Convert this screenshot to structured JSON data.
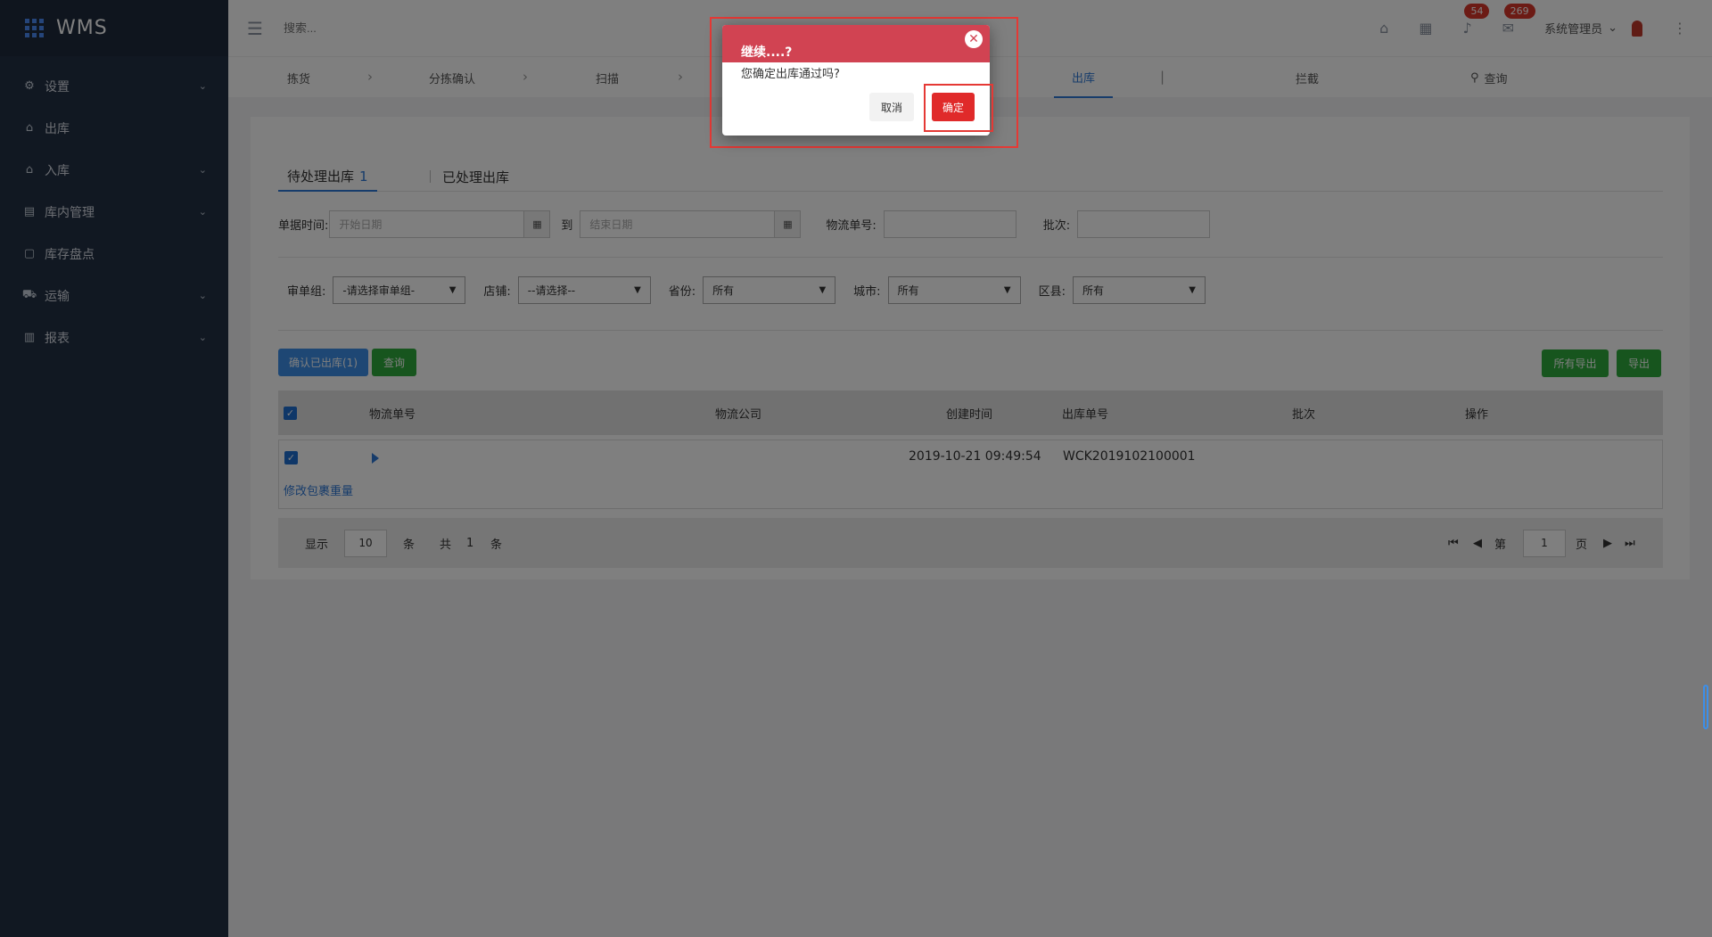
{
  "app": {
    "name": "WMS"
  },
  "sidebar": {
    "items": [
      {
        "label": "设置",
        "icon": "gear-icon",
        "has_children": true
      },
      {
        "label": "出库",
        "icon": "outbound-icon",
        "has_children": false
      },
      {
        "label": "入库",
        "icon": "inbound-icon",
        "has_children": true
      },
      {
        "label": "库内管理",
        "icon": "warehouse-icon",
        "has_children": true
      },
      {
        "label": "库存盘点",
        "icon": "inventory-icon",
        "has_children": false
      },
      {
        "label": "运输",
        "icon": "truck-icon",
        "has_children": true
      },
      {
        "label": "报表",
        "icon": "chart-icon",
        "has_children": true
      }
    ]
  },
  "header": {
    "search_placeholder": "搜索...",
    "notification_count": "54",
    "message_count": "269",
    "user_name": "系统管理员"
  },
  "steps": {
    "picking": "拣货",
    "sort_confirm": "分拣确认",
    "scan": "扫描",
    "outbound": "出库",
    "intercept": "拦截",
    "query": "查询"
  },
  "tabs": {
    "pending_label": "待处理出库",
    "pending_count": "1",
    "processed_label": "已处理出库"
  },
  "filters": {
    "doc_time_label": "单据时间:",
    "start_placeholder": "开始日期",
    "to_label": "到",
    "end_placeholder": "结束日期",
    "tracking_label": "物流单号:",
    "batch_label": "批次:",
    "review_group_label": "审单组:",
    "review_group_value": "-请选择审单组-",
    "store_label": "店铺:",
    "store_value": "--请选择--",
    "province_label": "省份:",
    "province_value": "所有",
    "city_label": "城市:",
    "city_value": "所有",
    "district_label": "区县:",
    "district_value": "所有"
  },
  "actions": {
    "confirm_outbound": "确认已出库(1)",
    "query": "查询",
    "export_all": "所有导出",
    "export": "导出"
  },
  "table": {
    "columns": [
      "物流单号",
      "物流公司",
      "创建时间",
      "出库单号",
      "批次",
      "操作"
    ],
    "rows": [
      {
        "created_at": "2019-10-21 09:49:54",
        "outbound_no": "WCK2019102100001",
        "edit_link": "修改包裹重量"
      }
    ]
  },
  "pager": {
    "show_label": "显示",
    "page_size": "10",
    "unit": "条",
    "total_label": "共",
    "total": "1",
    "page_label": "第",
    "page": "1",
    "page_unit": "页"
  },
  "dialog": {
    "title": "继续....?",
    "message": "您确定出库通过吗?",
    "cancel": "取消",
    "ok": "确定"
  },
  "colors": {
    "sidebar_bg": "#233044",
    "accent": "#2f78d6",
    "dialog_header": "#d14352",
    "ok_button": "#e02a2a",
    "green": "#2eaa3c",
    "highlight": "#e53935"
  }
}
